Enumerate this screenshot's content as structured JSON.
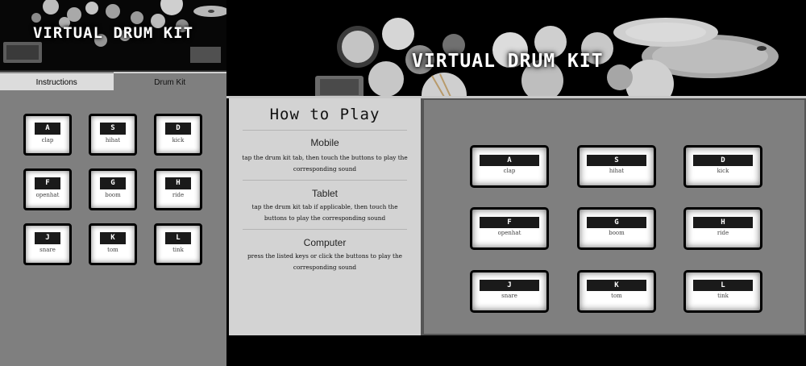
{
  "mobile": {
    "title": "VIRTUAL DRUM KIT",
    "tabs": [
      {
        "label": "Instructions"
      },
      {
        "label": "Drum Kit"
      }
    ]
  },
  "desktop": {
    "title": "VIRTUAL DRUM KIT"
  },
  "instructions": {
    "heading": "How to Play",
    "sections": [
      {
        "title": "Mobile",
        "text": "tap the drum kit tab, then touch the buttons to play the corresponding sound"
      },
      {
        "title": "Tablet",
        "text": "tap the drum kit tab if applicable, then touch the buttons to play the corresponding sound"
      },
      {
        "title": "Computer",
        "text": "press the listed keys or click the buttons to play the corresponding sound"
      }
    ]
  },
  "pads": [
    {
      "key": "A",
      "sound": "clap"
    },
    {
      "key": "S",
      "sound": "hihat"
    },
    {
      "key": "D",
      "sound": "kick"
    },
    {
      "key": "F",
      "sound": "openhat"
    },
    {
      "key": "G",
      "sound": "boom"
    },
    {
      "key": "H",
      "sound": "ride"
    },
    {
      "key": "J",
      "sound": "snare"
    },
    {
      "key": "K",
      "sound": "tom"
    },
    {
      "key": "L",
      "sound": "tink"
    }
  ],
  "colors": {
    "panel_gray": "#7f7f7f",
    "instructions_bg": "#d3d3d3",
    "key_bg": "#1a1a1a",
    "header_bg": "#000000"
  }
}
